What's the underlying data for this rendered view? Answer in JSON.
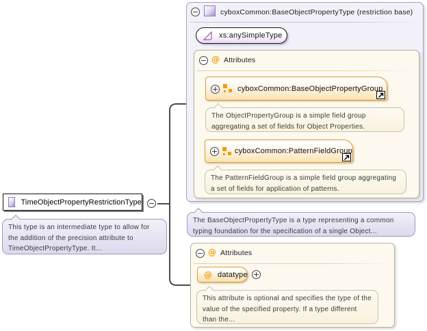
{
  "diagram": {
    "base_type": {
      "title": "cyboxCommon:BaseObjectPropertyType (restriction base)",
      "base": "xs:anySimpleType",
      "attributes": {
        "label": "Attributes",
        "groups": [
          {
            "name": "cyboxCommon:BaseObjectPropertyGroup",
            "description": "The ObjectPropertyGroup is a simple field group aggregating a set of fields for Object Properties."
          },
          {
            "name": "cyboxCommon:PatternFieldGroup",
            "description": "The PatternFieldGroup is a simple field group aggregating a set of fields for application of patterns."
          }
        ]
      },
      "description": "The BaseObjectPropertyType is a type representing a common typing foundation for the specification of a single Object..."
    },
    "restriction": {
      "name": "TimeObjectPropertyRestrictionType",
      "description": "This type is an intermediate type to allow for the addition of the precision attribute to TimeObjectPropertyType. It..."
    },
    "local_attributes": {
      "label": "Attributes",
      "attribute": {
        "name": "datatype",
        "description": "This attribute is optional and specifies the type of the value of the specified property. If a type different than the..."
      }
    }
  },
  "icons": {
    "collapse": "minus-circle",
    "expand": "plus-circle",
    "complex_type": "purple-gradient-square",
    "attribute": "orange-at-sign",
    "attribute_group": "orange-squares",
    "simple_type": "purple-triangle",
    "link": "north-east-arrow"
  },
  "colors": {
    "group_border": "#dd9c35",
    "group_fill": "#fbe8c2",
    "attribute_at": "#f39c12",
    "complex_type_fill": "#a893d2",
    "panel_lavender": "#f2f1fa",
    "panel_cream": "#fdf9ef",
    "tooltip_lavender": "#e2e0f1",
    "tooltip_cream": "#faf5e5",
    "connector": "#4a4a4a"
  }
}
